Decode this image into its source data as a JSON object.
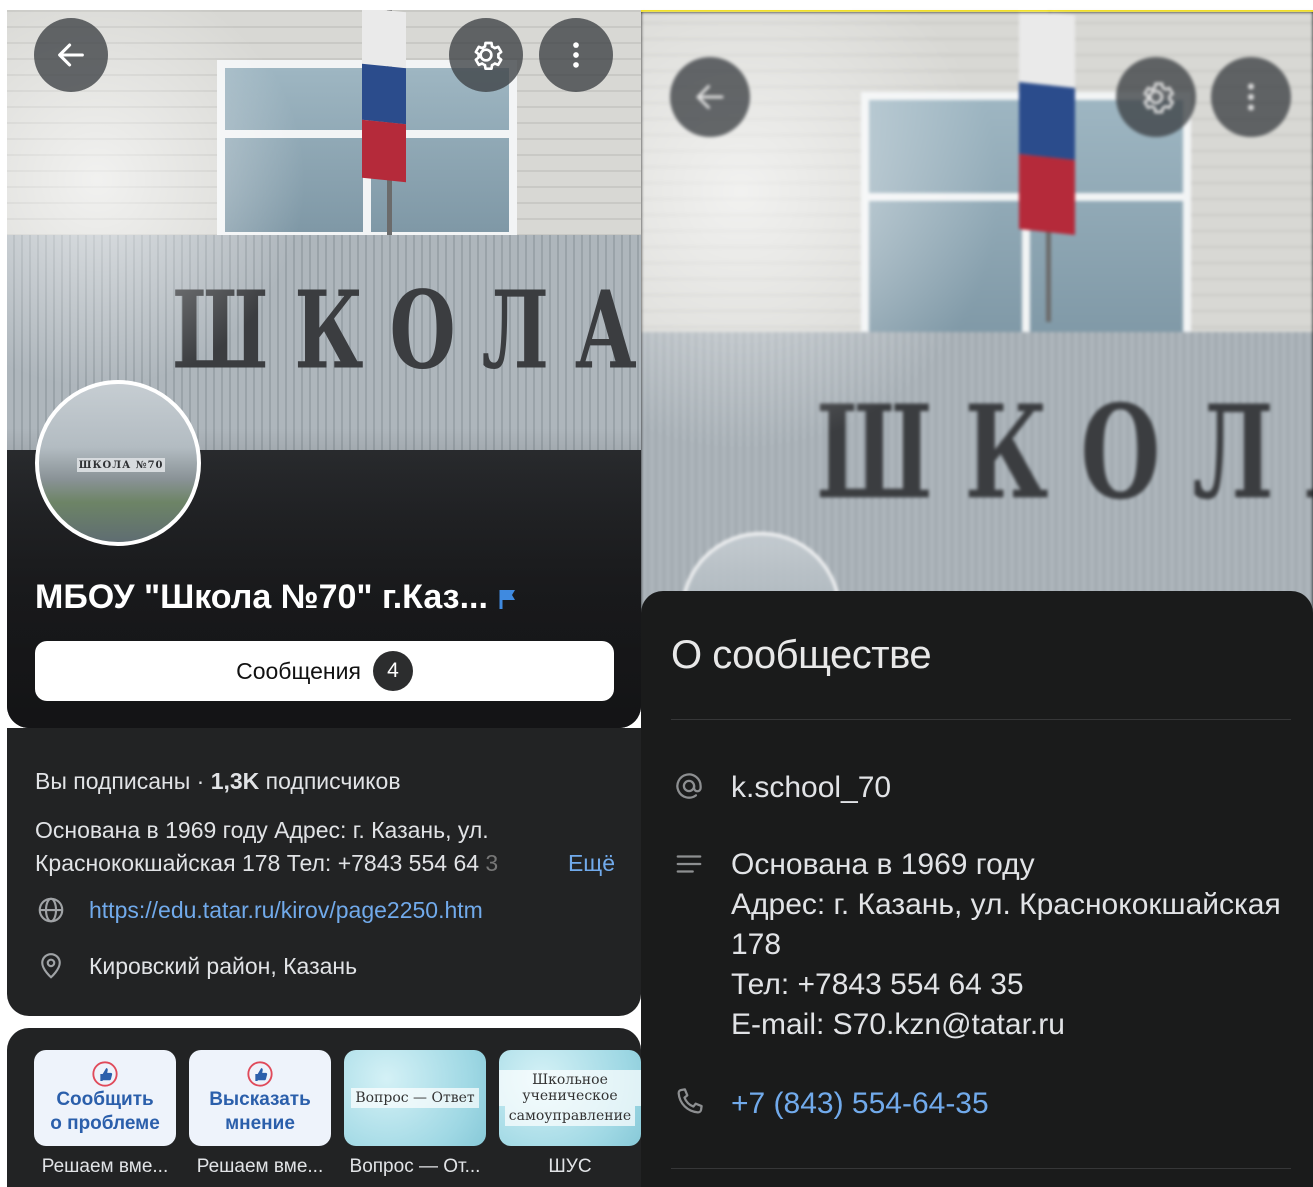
{
  "left": {
    "header": {
      "back": "back",
      "settings": "settings",
      "more": "more"
    },
    "avatar_sign": "ШКОЛА №70",
    "hero_sign": "ШКОЛА",
    "title": "МБОУ \"Школа №70\" г.Каз...",
    "messages_button": {
      "label": "Сообщения",
      "badge": "4"
    },
    "subs": {
      "status": "Вы подписаны",
      "sep": " · ",
      "count": "1,3K",
      "suffix": " подписчиков"
    },
    "description": {
      "line1": "Основана в 1969 году Адрес: г. Казань, ул.",
      "line2": "Краснококшайская 178 Тел: +7843 554 64",
      "line2_fade": " 3",
      "more": "Ещё"
    },
    "website": "https://edu.tatar.ru/kirov/page2250.htm",
    "location": "Кировский район, Казань",
    "widgets": [
      {
        "tile": [
          "Сообщить",
          "о проблеме"
        ],
        "caption": "Решаем вме..."
      },
      {
        "tile": [
          "Высказать",
          "мнение"
        ],
        "caption": "Решаем вме..."
      },
      {
        "tile": [
          "Вопрос — Ответ"
        ],
        "caption": "Вопрос — От..."
      },
      {
        "tile": [
          "Школьное ученическое",
          "самоуправление"
        ],
        "caption": "ШУС"
      }
    ]
  },
  "right": {
    "sheet_title": "О сообществе",
    "handle": "k.school_70",
    "about_lines": [
      "Основана в 1969 году",
      "Адрес: г. Казань, ул. Краснококшайская",
      "178",
      "Тел: +7843 554 64 35",
      "E-mail: S70.kzn@tatar.ru"
    ],
    "phone": "+7 (843) 554-64-35"
  },
  "colors": {
    "link": "#71aaeb",
    "card": "#222324",
    "sheet": "#1a1b1b",
    "text": "#e1e3e6",
    "badge": "#2c2d2e"
  },
  "icons": [
    "arrow-left-icon",
    "gear-icon",
    "dots-vertical-icon",
    "flag-icon",
    "globe-icon",
    "location-pin-icon",
    "at-icon",
    "lines-icon",
    "phone-icon",
    "thumbs-up-icon"
  ]
}
